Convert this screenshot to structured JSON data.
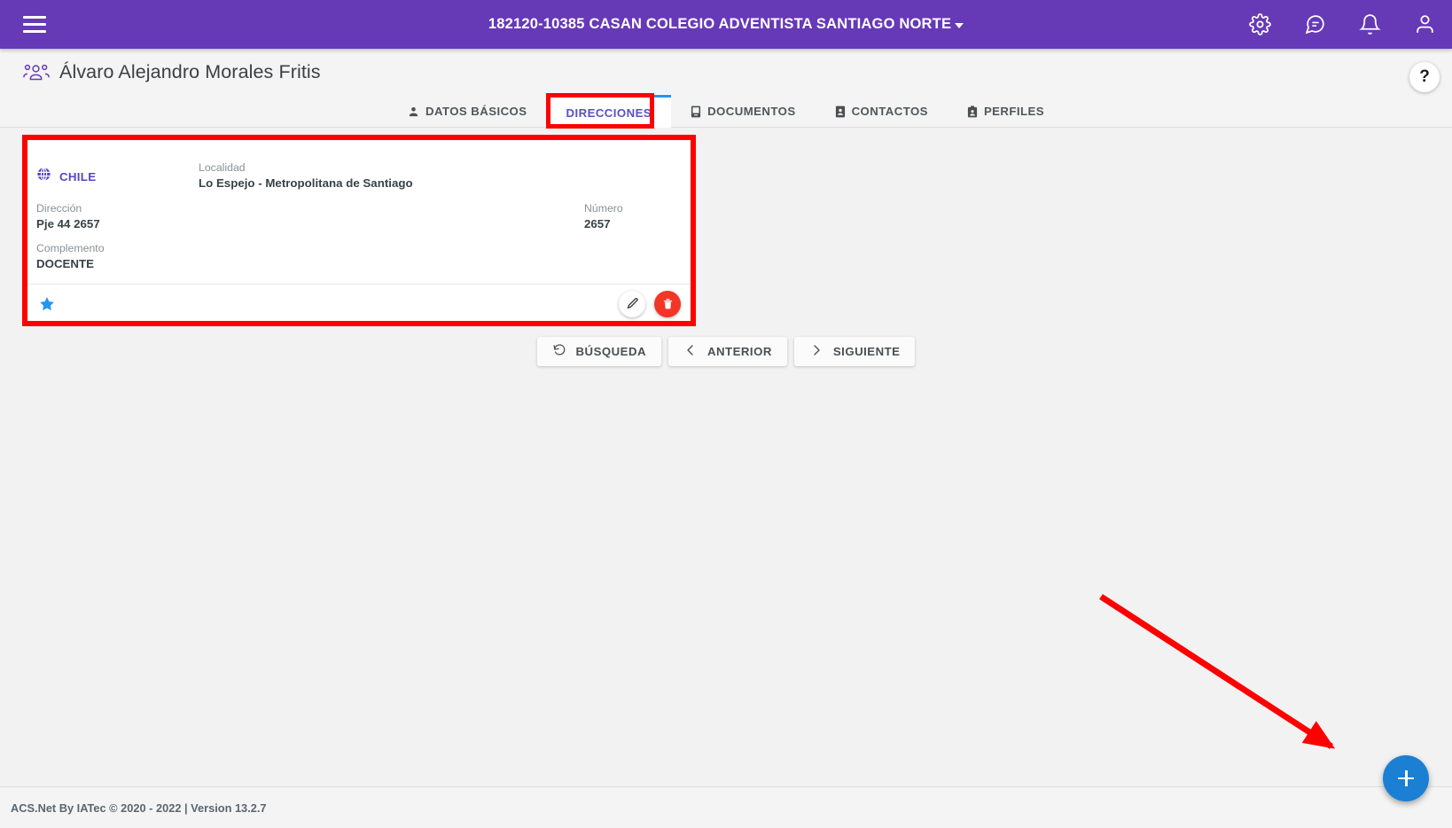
{
  "topbar": {
    "menu_icon": "hamburger-icon",
    "title": "182120-10385 CASAN COLEGIO ADVENTISTA SANTIAGO NORTE",
    "icons": [
      {
        "name": "gear-icon",
        "label": "Configuración"
      },
      {
        "name": "chat-icon",
        "label": "Mensajes"
      },
      {
        "name": "bell-icon",
        "label": "Notificaciones"
      },
      {
        "name": "user-icon",
        "label": "Usuario"
      }
    ]
  },
  "page": {
    "icon": "people-group-icon",
    "title": "Álvaro Alejandro Morales Fritis",
    "help_label": "?"
  },
  "tabs": [
    {
      "label": "DATOS BÁSICOS",
      "icon": "person-icon",
      "active": false
    },
    {
      "label": "DIRECCIONES",
      "icon": "none",
      "active": true
    },
    {
      "label": "DOCUMENTOS",
      "icon": "book-icon",
      "active": false
    },
    {
      "label": "CONTACTOS",
      "icon": "contact-card-icon",
      "active": false
    },
    {
      "label": "PERFILES",
      "icon": "badge-icon",
      "active": false
    }
  ],
  "address_card": {
    "country_icon": "globe-icon",
    "country": "CHILE",
    "fields": {
      "localidad_label": "Localidad",
      "localidad_value": "Lo Espejo - Metropolitana de Santiago",
      "direccion_label": "Dirección",
      "direccion_value": "Pje 44 2657",
      "numero_label": "Número",
      "numero_value": "2657",
      "complemento_label": "Complemento",
      "complemento_value": "DOCENTE"
    },
    "footer": {
      "favorite_icon": "star-icon",
      "edit_icon": "pencil-icon",
      "delete_icon": "trash-icon"
    }
  },
  "nav_buttons": [
    {
      "label": "BÚSQUEDA",
      "icon": "refresh-ccw-icon"
    },
    {
      "label": "ANTERIOR",
      "icon": "chevron-left-icon"
    },
    {
      "label": "SIGUIENTE",
      "icon": "chevron-right-icon"
    }
  ],
  "fab": {
    "icon": "plus-icon",
    "label": "Agregar"
  },
  "footer": {
    "text": "ACS.Net By IATec © 2020 - 2022 | Version 13.2.7"
  },
  "colors": {
    "topbar_purple": "#6639b7",
    "tab_active_text": "#5a4fc4",
    "tab_active_underline": "#2196f3",
    "country_purple": "#5744c0",
    "star_blue": "#2196f3",
    "delete_red": "#f33527",
    "fab_blue": "#1b7fd4",
    "annotation_red": "#fe0000",
    "page_bg": "#f2f2f2"
  },
  "annotations": [
    {
      "name": "highlight-direcciones-tab",
      "type": "rectangle",
      "color": "#fe0000"
    },
    {
      "name": "highlight-address-card",
      "type": "rectangle",
      "color": "#fe0000"
    },
    {
      "name": "pointer-to-add-button",
      "type": "arrow",
      "color": "#fe0000"
    }
  ]
}
